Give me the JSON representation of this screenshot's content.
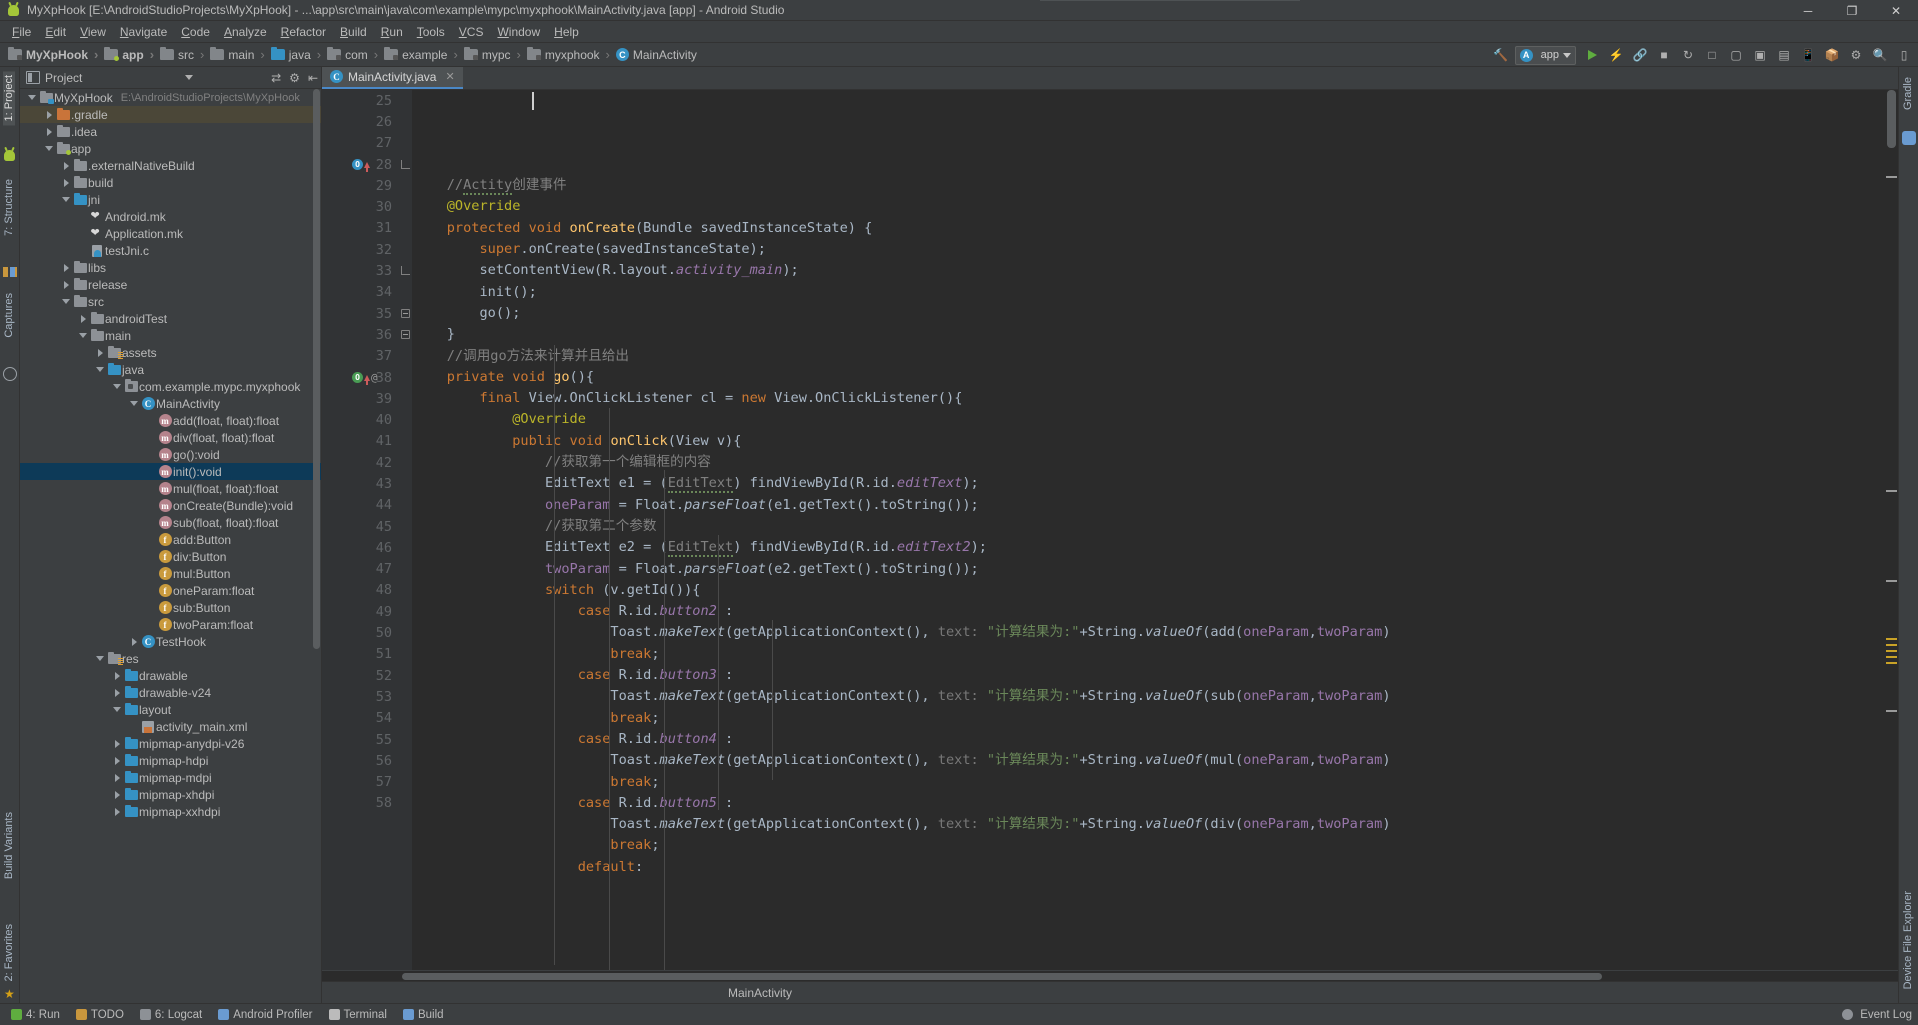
{
  "window": {
    "title": "MyXpHook [E:\\AndroidStudioProjects\\MyXpHook] - ...\\app\\src\\main\\java\\com\\example\\mypc\\myxphook\\MainActivity.java [app] - Android Studio",
    "app_icon": "android-robot-icon",
    "minimize": "─",
    "maximize": "❐",
    "close": "✕"
  },
  "menu": {
    "items": [
      "File",
      "Edit",
      "View",
      "Navigate",
      "Code",
      "Analyze",
      "Refactor",
      "Build",
      "Run",
      "Tools",
      "VCS",
      "Window",
      "Help"
    ]
  },
  "breadcrumbs": [
    {
      "label": "MyXpHook",
      "icon": "module-folder-icon",
      "bold": true
    },
    {
      "label": "app",
      "icon": "app-folder-icon",
      "bold": true
    },
    {
      "label": "src",
      "icon": "folder-icon",
      "bold": false
    },
    {
      "label": "main",
      "icon": "folder-icon",
      "bold": false
    },
    {
      "label": "java",
      "icon": "source-folder-icon",
      "bold": false
    },
    {
      "label": "com",
      "icon": "package-icon",
      "bold": false
    },
    {
      "label": "example",
      "icon": "package-icon",
      "bold": false
    },
    {
      "label": "mypc",
      "icon": "package-icon",
      "bold": false
    },
    {
      "label": "myxphook",
      "icon": "package-icon",
      "bold": false
    },
    {
      "label": "MainActivity",
      "icon": "class-icon",
      "bold": false
    }
  ],
  "toolbar": {
    "run_config": "app",
    "icons": [
      "hammer-build-icon",
      "sync-gradle-icon",
      "avd-manager-icon",
      "sdk-manager-icon",
      "project-structure-icon",
      "settings-gear-icon",
      "search-icon",
      "layout-inspector-icon"
    ]
  },
  "project_panel": {
    "title": "Project",
    "icons": [
      "collapse-all-icon",
      "settings-gear-icon",
      "hide-panel-icon"
    ],
    "tree": [
      {
        "depth": 0,
        "arrow": "down",
        "icon": "module-folder-icon",
        "label": "MyXpHook",
        "sub": "E:\\AndroidStudioProjects\\MyXpHook",
        "state": "normal"
      },
      {
        "depth": 1,
        "arrow": "right",
        "icon": "orange-folder-icon",
        "label": ".gradle",
        "sub": "",
        "state": "highlight"
      },
      {
        "depth": 1,
        "arrow": "right",
        "icon": "folder-icon",
        "label": ".idea",
        "sub": "",
        "state": "normal"
      },
      {
        "depth": 1,
        "arrow": "down",
        "icon": "app-folder-icon",
        "label": "app",
        "sub": "",
        "state": "normal"
      },
      {
        "depth": 2,
        "arrow": "right",
        "icon": "folder-icon",
        "label": ".externalNativeBuild",
        "sub": "",
        "state": "normal"
      },
      {
        "depth": 2,
        "arrow": "right",
        "icon": "folder-icon",
        "label": "build",
        "sub": "",
        "state": "normal"
      },
      {
        "depth": 2,
        "arrow": "down",
        "icon": "source-folder-icon",
        "label": "jni",
        "sub": "",
        "state": "normal"
      },
      {
        "depth": 3,
        "arrow": "none",
        "icon": "mk-file-icon",
        "label": "Android.mk",
        "sub": "",
        "state": "normal"
      },
      {
        "depth": 3,
        "arrow": "none",
        "icon": "mk-file-icon",
        "label": "Application.mk",
        "sub": "",
        "state": "normal"
      },
      {
        "depth": 3,
        "arrow": "none",
        "icon": "c-file-icon",
        "label": "testJni.c",
        "sub": "",
        "state": "normal"
      },
      {
        "depth": 2,
        "arrow": "right",
        "icon": "folder-icon",
        "label": "libs",
        "sub": "",
        "state": "normal"
      },
      {
        "depth": 2,
        "arrow": "right",
        "icon": "folder-icon",
        "label": "release",
        "sub": "",
        "state": "normal"
      },
      {
        "depth": 2,
        "arrow": "down",
        "icon": "folder-icon",
        "label": "src",
        "sub": "",
        "state": "normal"
      },
      {
        "depth": 3,
        "arrow": "right",
        "icon": "folder-icon",
        "label": "androidTest",
        "sub": "",
        "state": "normal"
      },
      {
        "depth": 3,
        "arrow": "down",
        "icon": "folder-icon",
        "label": "main",
        "sub": "",
        "state": "normal"
      },
      {
        "depth": 4,
        "arrow": "right",
        "icon": "res-folder-icon",
        "label": "assets",
        "sub": "",
        "state": "normal"
      },
      {
        "depth": 4,
        "arrow": "down",
        "icon": "source-folder-icon",
        "label": "java",
        "sub": "",
        "state": "normal"
      },
      {
        "depth": 5,
        "arrow": "down",
        "icon": "package-icon",
        "label": "com.example.mypc.myxphook",
        "sub": "",
        "state": "normal"
      },
      {
        "depth": 6,
        "arrow": "down",
        "icon": "class-icon",
        "label": "MainActivity",
        "sub": "",
        "state": "normal"
      },
      {
        "depth": 7,
        "arrow": "none",
        "icon": "method-icon",
        "label": "add(float, float):float",
        "sub": "",
        "state": "normal"
      },
      {
        "depth": 7,
        "arrow": "none",
        "icon": "method-icon",
        "label": "div(float, float):float",
        "sub": "",
        "state": "normal"
      },
      {
        "depth": 7,
        "arrow": "none",
        "icon": "method-icon",
        "label": "go():void",
        "sub": "",
        "state": "normal"
      },
      {
        "depth": 7,
        "arrow": "none",
        "icon": "method-icon",
        "label": "init():void",
        "sub": "",
        "state": "selected"
      },
      {
        "depth": 7,
        "arrow": "none",
        "icon": "method-icon",
        "label": "mul(float, float):float",
        "sub": "",
        "state": "normal"
      },
      {
        "depth": 7,
        "arrow": "none",
        "icon": "method-icon",
        "label": "onCreate(Bundle):void",
        "sub": "",
        "state": "normal"
      },
      {
        "depth": 7,
        "arrow": "none",
        "icon": "method-icon",
        "label": "sub(float, float):float",
        "sub": "",
        "state": "normal"
      },
      {
        "depth": 7,
        "arrow": "none",
        "icon": "field-icon",
        "label": "add:Button",
        "sub": "",
        "state": "normal"
      },
      {
        "depth": 7,
        "arrow": "none",
        "icon": "field-icon",
        "label": "div:Button",
        "sub": "",
        "state": "normal"
      },
      {
        "depth": 7,
        "arrow": "none",
        "icon": "field-icon",
        "label": "mul:Button",
        "sub": "",
        "state": "normal"
      },
      {
        "depth": 7,
        "arrow": "none",
        "icon": "field-icon",
        "label": "oneParam:float",
        "sub": "",
        "state": "normal"
      },
      {
        "depth": 7,
        "arrow": "none",
        "icon": "field-icon",
        "label": "sub:Button",
        "sub": "",
        "state": "normal"
      },
      {
        "depth": 7,
        "arrow": "none",
        "icon": "field-icon",
        "label": "twoParam:float",
        "sub": "",
        "state": "normal"
      },
      {
        "depth": 6,
        "arrow": "right",
        "icon": "class-icon",
        "label": "TestHook",
        "sub": "",
        "state": "normal"
      },
      {
        "depth": 4,
        "arrow": "down",
        "icon": "res-folder-icon",
        "label": "res",
        "sub": "",
        "state": "normal"
      },
      {
        "depth": 5,
        "arrow": "right",
        "icon": "source-folder-icon",
        "label": "drawable",
        "sub": "",
        "state": "normal"
      },
      {
        "depth": 5,
        "arrow": "right",
        "icon": "source-folder-icon",
        "label": "drawable-v24",
        "sub": "",
        "state": "normal"
      },
      {
        "depth": 5,
        "arrow": "down",
        "icon": "source-folder-icon",
        "label": "layout",
        "sub": "",
        "state": "normal"
      },
      {
        "depth": 6,
        "arrow": "none",
        "icon": "xml-file-icon",
        "label": "activity_main.xml",
        "sub": "",
        "state": "normal"
      },
      {
        "depth": 5,
        "arrow": "right",
        "icon": "source-folder-icon",
        "label": "mipmap-anydpi-v26",
        "sub": "",
        "state": "normal"
      },
      {
        "depth": 5,
        "arrow": "right",
        "icon": "source-folder-icon",
        "label": "mipmap-hdpi",
        "sub": "",
        "state": "normal"
      },
      {
        "depth": 5,
        "arrow": "right",
        "icon": "source-folder-icon",
        "label": "mipmap-mdpi",
        "sub": "",
        "state": "normal"
      },
      {
        "depth": 5,
        "arrow": "right",
        "icon": "source-folder-icon",
        "label": "mipmap-xhdpi",
        "sub": "",
        "state": "normal"
      },
      {
        "depth": 5,
        "arrow": "right",
        "icon": "source-folder-icon",
        "label": "mipmap-xxhdpi",
        "sub": "",
        "state": "normal"
      }
    ]
  },
  "left_strip": [
    {
      "label": "1: Project",
      "selected": true,
      "icon": "project-icon"
    },
    {
      "label": "7: Structure",
      "selected": false,
      "icon": "structure-icon"
    },
    {
      "label": "Captures",
      "selected": false,
      "icon": "captures-icon"
    },
    {
      "label": "Build Variants",
      "selected": false,
      "icon": "build-variants-icon"
    },
    {
      "label": "2: Favorites",
      "selected": false,
      "icon": "favorites-icon"
    }
  ],
  "right_strip": [
    {
      "label": "Gradle",
      "icon": "gradle-icon"
    },
    {
      "label": "Device File Explorer",
      "icon": "device-file-explorer-icon"
    }
  ],
  "editor": {
    "tab": {
      "label": "MainActivity.java",
      "icon": "class-icon",
      "close": "✕"
    },
    "breadcrumb": "MainActivity",
    "first_line": 25,
    "lines": [
      {
        "n": 25,
        "gutter": null,
        "fold": null,
        "html": ""
      },
      {
        "n": 26,
        "gutter": null,
        "fold": null,
        "html": "    <span class=\"cm\">//<span class=\"wavy\">Actity</span>创建事件</span>"
      },
      {
        "n": 27,
        "gutter": null,
        "fold": null,
        "html": "    <span class=\"an\">@Override</span>"
      },
      {
        "n": 28,
        "gutter": "override-blue",
        "fold": "end",
        "html": "    <span class=\"k\">protected void </span><span class=\"mth\">onCreate</span>(Bundle savedInstanceState) {"
      },
      {
        "n": 29,
        "gutter": null,
        "fold": null,
        "html": "        <span class=\"k\">super</span>.onCreate(savedInstanceState);"
      },
      {
        "n": 30,
        "gutter": null,
        "fold": null,
        "html": "        setContentView(R.layout.<span class=\"fld ital\">activity_main</span>);"
      },
      {
        "n": 31,
        "gutter": null,
        "fold": null,
        "html": "        init();"
      },
      {
        "n": 32,
        "gutter": null,
        "fold": null,
        "html": "        go();"
      },
      {
        "n": 33,
        "gutter": null,
        "fold": "end",
        "html": "    }"
      },
      {
        "n": 34,
        "gutter": null,
        "fold": null,
        "html": "    <span class=\"cm\">//调用go方法来计算并且给出</span>"
      },
      {
        "n": 35,
        "gutter": null,
        "fold": "start",
        "html": "    <span class=\"k\">private void </span><span class=\"mth\">go</span>(){"
      },
      {
        "n": 36,
        "gutter": null,
        "fold": "start",
        "html": "        <span class=\"k\">final </span>View.OnClickListener cl = <span class=\"k\">new </span>View.OnClickListener(){"
      },
      {
        "n": 37,
        "gutter": null,
        "fold": null,
        "html": "            <span class=\"an\">@Override</span>"
      },
      {
        "n": 38,
        "gutter": "override-green-at",
        "fold": null,
        "html": "            <span class=\"k\">public void </span><span class=\"mth\">onClick</span>(View v){"
      },
      {
        "n": 39,
        "gutter": null,
        "fold": null,
        "html": "                <span class=\"cm\">//获取第一个编辑框的内容</span>"
      },
      {
        "n": 40,
        "gutter": null,
        "fold": null,
        "html": "                EditText e1 = (<span class=\"cm wavy\">EditText</span>) findViewById(R.id.<span class=\"fld ital\">editText</span>);"
      },
      {
        "n": 41,
        "gutter": null,
        "fold": null,
        "html": "                <span class=\"fld\">oneParam</span> = Float.<span class=\"ital\">parseFloat</span>(e1.getText().toString());"
      },
      {
        "n": 42,
        "gutter": null,
        "fold": null,
        "html": "                <span class=\"cm\">//获取第二个参数</span>"
      },
      {
        "n": 43,
        "gutter": null,
        "fold": null,
        "html": "                EditText e2 = (<span class=\"cm wavy\">EditText</span>) findViewById(R.id.<span class=\"fld ital\">editText2</span>);"
      },
      {
        "n": 44,
        "gutter": null,
        "fold": null,
        "html": "                <span class=\"fld\">twoParam</span> = Float.<span class=\"ital\">parseFloat</span>(e2.getText().toString());"
      },
      {
        "n": 45,
        "gutter": null,
        "fold": null,
        "html": "                <span class=\"k\">switch </span>(v.getId()){"
      },
      {
        "n": 46,
        "gutter": null,
        "fold": null,
        "html": "                    <span class=\"k\">case </span>R.id.<span class=\"fld ital\">button2</span> :"
      },
      {
        "n": 47,
        "gutter": null,
        "fold": null,
        "html": "                        Toast.<span class=\"ital\">makeText</span>(getApplicationContext(), <span class=\"hintlbl\">text:</span> <span class=\"st\">\"计算结果为:\"</span>+String.<span class=\"ital\">valueOf</span>(add(<span class=\"fld\">oneParam</span>,<span class=\"fld\">twoParam</span>)"
      },
      {
        "n": 48,
        "gutter": null,
        "fold": null,
        "html": "                        <span class=\"k\">break</span>;"
      },
      {
        "n": 49,
        "gutter": null,
        "fold": null,
        "html": "                    <span class=\"k\">case </span>R.id.<span class=\"fld ital\">button3</span> :"
      },
      {
        "n": 50,
        "gutter": null,
        "fold": null,
        "html": "                        Toast.<span class=\"ital\">makeText</span>(getApplicationContext(), <span class=\"hintlbl\">text:</span> <span class=\"st\">\"计算结果为:\"</span>+String.<span class=\"ital\">valueOf</span>(sub(<span class=\"fld\">oneParam</span>,<span class=\"fld\">twoParam</span>)"
      },
      {
        "n": 51,
        "gutter": null,
        "fold": null,
        "html": "                        <span class=\"k\">break</span>;"
      },
      {
        "n": 52,
        "gutter": null,
        "fold": null,
        "html": "                    <span class=\"k\">case </span>R.id.<span class=\"fld ital\">button4</span> :"
      },
      {
        "n": 53,
        "gutter": null,
        "fold": null,
        "html": "                        Toast.<span class=\"ital\">makeText</span>(getApplicationContext(), <span class=\"hintlbl\">text:</span> <span class=\"st\">\"计算结果为:\"</span>+String.<span class=\"ital\">valueOf</span>(mul(<span class=\"fld\">oneParam</span>,<span class=\"fld\">twoParam</span>)"
      },
      {
        "n": 54,
        "gutter": null,
        "fold": null,
        "html": "                        <span class=\"k\">break</span>;"
      },
      {
        "n": 55,
        "gutter": null,
        "fold": null,
        "html": "                    <span class=\"k\">case </span>R.id.<span class=\"fld ital\">button5</span> :"
      },
      {
        "n": 56,
        "gutter": null,
        "fold": null,
        "html": "                        Toast.<span class=\"ital\">makeText</span>(getApplicationContext(), <span class=\"hintlbl\">text:</span> <span class=\"st\">\"计算结果为:\"</span>+String.<span class=\"ital\">valueOf</span>(div(<span class=\"fld\">oneParam</span>,<span class=\"fld\">twoParam</span>)"
      },
      {
        "n": 57,
        "gutter": null,
        "fold": null,
        "html": "                        <span class=\"k\">break</span>;"
      },
      {
        "n": 58,
        "gutter": null,
        "fold": null,
        "html": "                    <span class=\"k\">default</span>:"
      }
    ]
  },
  "status_bar": {
    "left": [
      {
        "label": "4: Run",
        "icon": "run-icon"
      },
      {
        "label": "TODO",
        "icon": "todo-icon"
      },
      {
        "label": "6: Logcat",
        "icon": "logcat-icon"
      },
      {
        "label": "Android Profiler",
        "icon": "profiler-icon"
      },
      {
        "label": "Terminal",
        "icon": "terminal-icon"
      },
      {
        "label": "Build",
        "icon": "build-icon"
      }
    ],
    "right": [
      {
        "label": "Event Log",
        "icon": "event-log-icon"
      }
    ]
  }
}
